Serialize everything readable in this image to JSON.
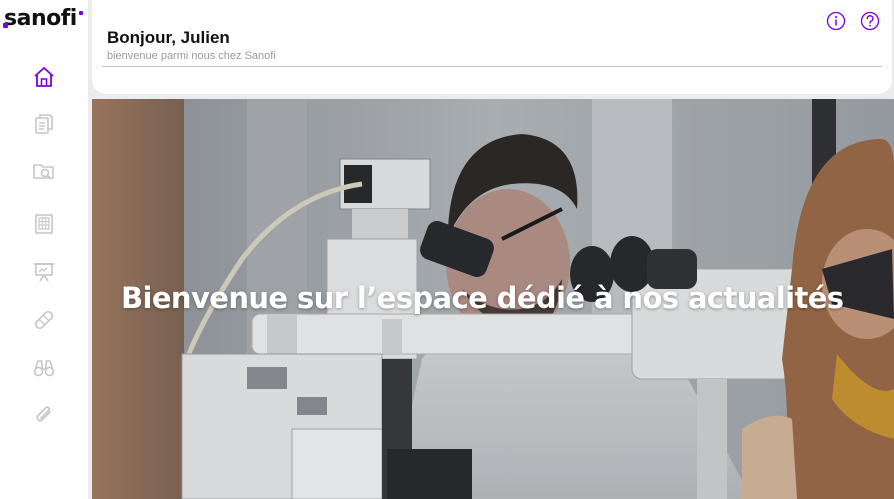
{
  "brand": {
    "logo_text": "sanofi",
    "accent_color": "#7a00e6"
  },
  "sidebar": {
    "items": [
      {
        "name": "home",
        "icon": "home-icon",
        "active": true
      },
      {
        "name": "documents",
        "icon": "documents-icon",
        "active": false
      },
      {
        "name": "folder-search",
        "icon": "folder-search-icon",
        "active": false
      },
      {
        "name": "building",
        "icon": "building-icon",
        "active": false
      },
      {
        "name": "presentation",
        "icon": "presentation-icon",
        "active": false
      },
      {
        "name": "bandage",
        "icon": "bandage-icon",
        "active": false
      },
      {
        "name": "binoculars",
        "icon": "binoculars-icon",
        "active": false
      },
      {
        "name": "attachment",
        "icon": "paperclip-icon",
        "active": false
      }
    ]
  },
  "header": {
    "greeting": "Bonjour, Julien",
    "subtitle": "bienvenue parmi nous chez Sanofi",
    "info_icon": "info-icon",
    "help_icon": "help-icon"
  },
  "hero": {
    "title": "Bienvenue sur l’espace dédié à nos actualités",
    "image": "laboratory-microscope-photo"
  }
}
